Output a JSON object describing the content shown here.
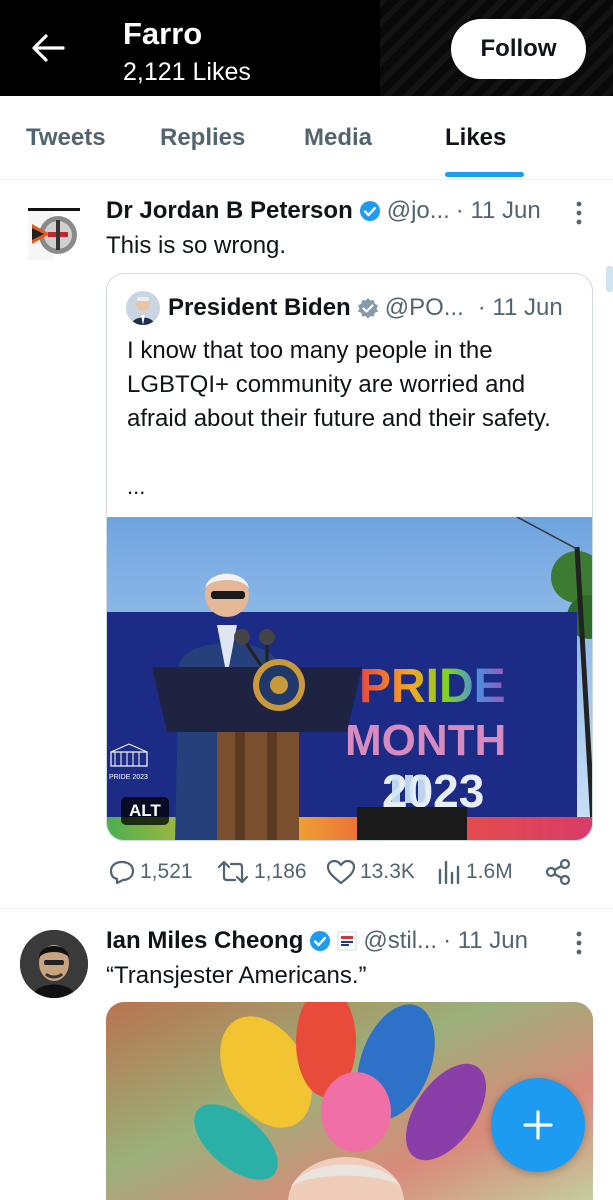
{
  "header": {
    "title": "Farro",
    "subtitle": "2,121 Likes",
    "follow_label": "Follow"
  },
  "tabs": [
    {
      "label": "Tweets",
      "active": false
    },
    {
      "label": "Replies",
      "active": false
    },
    {
      "label": "Media",
      "active": false
    },
    {
      "label": "Likes",
      "active": true
    }
  ],
  "tweets": [
    {
      "name": "Dr Jordan B Peterson",
      "handle": "@jo...",
      "time": "· 11 Jun",
      "text": "This is so wrong.",
      "quote": {
        "name": "President Biden",
        "handle": "@PO...",
        "time": "· 11 Jun",
        "text": "I know that too many people in the LGBTQI+ community are worried and afraid about their future and their safety.",
        "ellipsis": "...",
        "image_sign": [
          "PRIDE",
          "MONTH",
          "2023"
        ],
        "image_small_text": "PRIDE 2023",
        "alt_label": "ALT"
      },
      "stats": {
        "replies": "1,521",
        "retweets": "1,186",
        "likes": "13.3K",
        "views": "1.6M"
      }
    },
    {
      "name": "Ian Miles Cheong",
      "handle": "@stil...",
      "time": "· 11 Jun",
      "text": "“Transjester Americans.”"
    }
  ],
  "colors": {
    "accent": "#1d9bf0",
    "text": "#0f1419",
    "muted": "#536471"
  },
  "icons": [
    "back-arrow-icon",
    "verified-icon",
    "more-icon",
    "reply-icon",
    "retweet-icon",
    "like-icon",
    "views-icon",
    "share-icon",
    "compose-plus-icon"
  ]
}
